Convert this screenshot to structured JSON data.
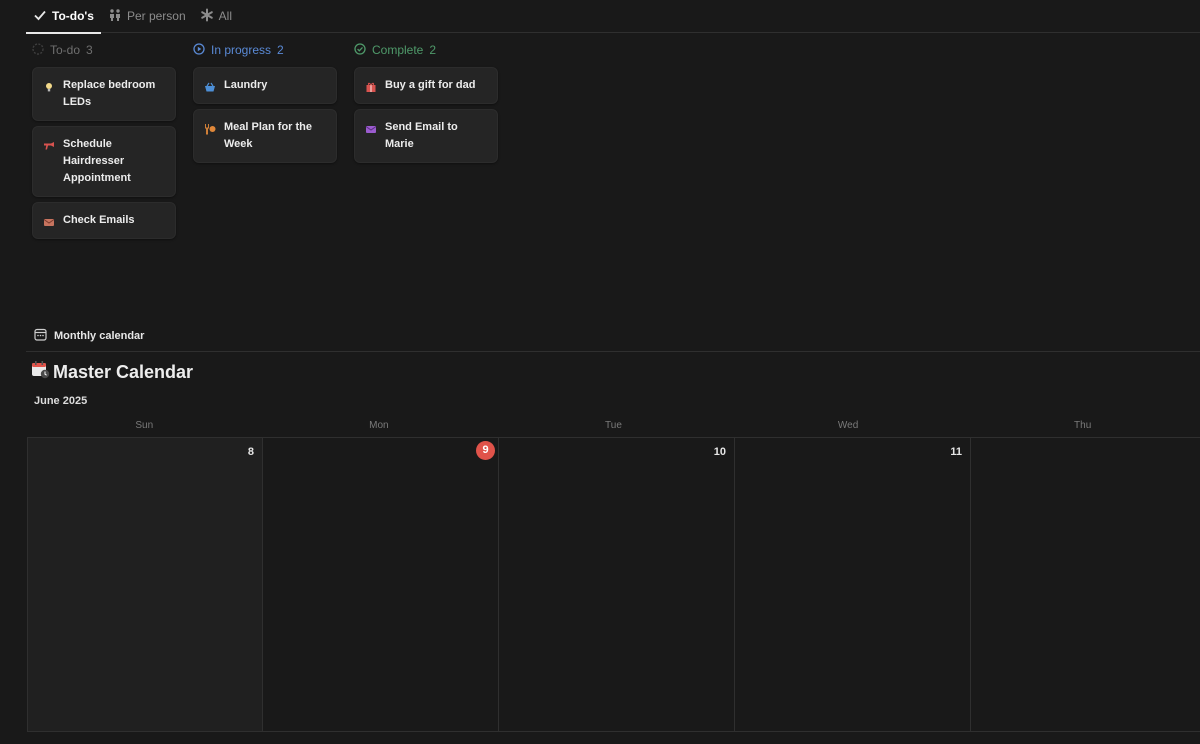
{
  "tabs": [
    {
      "label": "To-do's",
      "icon": "check-icon"
    },
    {
      "label": "Per person",
      "icon": "people-icon"
    },
    {
      "label": "All",
      "icon": "asterisk-icon"
    }
  ],
  "board": {
    "columns": [
      {
        "title": "To-do",
        "count": "3",
        "color": "#6f6f6f",
        "cards": [
          {
            "title": "Replace bedroom LEDs",
            "icon": "lightbulb-icon"
          },
          {
            "title": "Schedule Hairdresser Appointment",
            "icon": "hairdryer-icon"
          },
          {
            "title": "Check Emails",
            "icon": "envelope-icon"
          }
        ]
      },
      {
        "title": "In progress",
        "count": "2",
        "color": "#5a8ad6",
        "cards": [
          {
            "title": "Laundry",
            "icon": "basket-icon"
          },
          {
            "title": "Meal Plan for the Week",
            "icon": "cutlery-icon"
          }
        ]
      },
      {
        "title": "Complete",
        "count": "2",
        "color": "#4f9a6a",
        "cards": [
          {
            "title": "Buy a gift for dad",
            "icon": "gift-icon"
          },
          {
            "title": "Send Email to Marie",
            "icon": "envelope-icon"
          }
        ]
      }
    ]
  },
  "calendar": {
    "link_label": "Monthly calendar",
    "title": "Master Calendar",
    "month": "June 2025",
    "weekdays": [
      "Sun",
      "Mon",
      "Tue",
      "Wed",
      "Thu"
    ],
    "days": [
      "8",
      "9",
      "10",
      "11",
      ""
    ],
    "today": "9",
    "today_color": "#e0534a"
  }
}
